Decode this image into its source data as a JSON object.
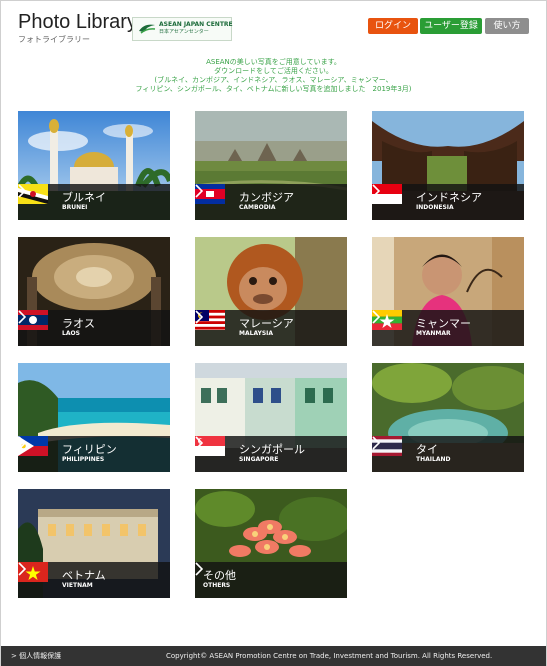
{
  "header": {
    "title": "Photo Library",
    "subtitle": "フォトライブラリー",
    "partner_name": "ASEAN JAPAN CENTRE",
    "partner_sub": "日本アセアンセンター",
    "buttons": {
      "login": "ログイン",
      "register": "ユーザー登録",
      "help": "使い方"
    },
    "colors": {
      "login": "#e8530f",
      "register": "#2a9d35",
      "help": "#8e8e8e"
    }
  },
  "notice": {
    "lines": [
      "ASEANの美しい写真をご用意しています。",
      "ダウンロードをしてご活用ください。",
      "(ブルネイ、カンボジア、インドネシア、ラオス、マレーシア、ミャンマー、",
      "フィリピン、シンガポール、タイ、ベトナムに新しい写真を追加しました　2019年3月)"
    ]
  },
  "countries": [
    {
      "jp": "ブルネイ",
      "en": "BRUNEI",
      "flag": "brunei-flag-icon",
      "photo": "mosque"
    },
    {
      "jp": "カンボジア",
      "en": "CAMBODIA",
      "flag": "cambodia-flag-icon",
      "photo": "angkor"
    },
    {
      "jp": "インドネシア",
      "en": "INDONESIA",
      "flag": "indonesia-flag-icon",
      "photo": "torajan-houses"
    },
    {
      "jp": "ラオス",
      "en": "LAOS",
      "flag": "laos-flag-icon",
      "photo": "temple-ceiling"
    },
    {
      "jp": "マレーシア",
      "en": "MALAYSIA",
      "flag": "malaysia-flag-icon",
      "photo": "orangutan"
    },
    {
      "jp": "ミャンマー",
      "en": "MYANMAR",
      "flag": "myanmar-flag-icon",
      "photo": "woman-with-umbrella"
    },
    {
      "jp": "フィリピン",
      "en": "PHILIPPINES",
      "flag": "philippines-flag-icon",
      "photo": "beach"
    },
    {
      "jp": "シンガポール",
      "en": "SINGAPORE",
      "flag": "singapore-flag-icon",
      "photo": "shophouses"
    },
    {
      "jp": "タイ",
      "en": "THAILAND",
      "flag": "thailand-flag-icon",
      "photo": "hot-spring"
    },
    {
      "jp": "ベトナム",
      "en": "VIETNAM",
      "flag": "vietnam-flag-icon",
      "photo": "colonial-hotel"
    },
    {
      "jp": "その他",
      "en": "OTHERS",
      "flag": "",
      "photo": "frangipani-flowers"
    }
  ],
  "footer": {
    "privacy": "> 個人情報保護",
    "copyright": "Copyright© ASEAN Promotion Centre on Trade, Investment and Tourism. All Rights Reserved."
  }
}
